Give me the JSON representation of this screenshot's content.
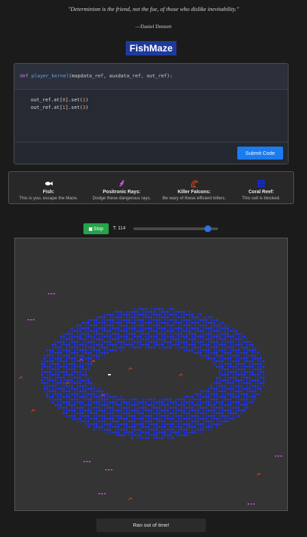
{
  "quote": "\"Determinism is the friend, not the foe, of those who dislike inevitability.\"",
  "author": "—Daniel Dennett",
  "title": "FishMaze",
  "code": {
    "def_kw": "def",
    "fn_name": "player_kernel",
    "params": "(mapdata_ref, auxdata_ref, out_ref):",
    "line1_a": "out_ref.at[",
    "line1_idx": "0",
    "line1_b": "].set(",
    "line1_val": "1",
    "line1_c": ")",
    "line2_a": "out_ref.at[",
    "line2_idx": "1",
    "line2_b": "].set(",
    "line2_val": "3",
    "line2_c": ")"
  },
  "submit_label": "Submit Code",
  "legend": [
    {
      "icon": "fish-icon",
      "title": "Fish:",
      "desc": "This is you, escape the Maze."
    },
    {
      "icon": "positronic-ray-icon",
      "title": "Positronic Rays:",
      "desc": "Dodge these dangerous rays."
    },
    {
      "icon": "falcon-icon",
      "title": "Killer Falcons:",
      "desc": "Be wary of these efficient killers."
    },
    {
      "icon": "coral-reef-icon",
      "title": "Coral Reef:",
      "desc": "This cell is blocked."
    }
  ],
  "controls": {
    "stop_label": "Stop",
    "time_label": "T: 114",
    "slider_fraction": 0.87
  },
  "colors": {
    "coral": "#1a2ee0",
    "ray": "#d84ee8",
    "falcon": "#d8401c",
    "fish": "#ffffff",
    "maze_bg": "#343434"
  },
  "status": "Ran out of time!"
}
